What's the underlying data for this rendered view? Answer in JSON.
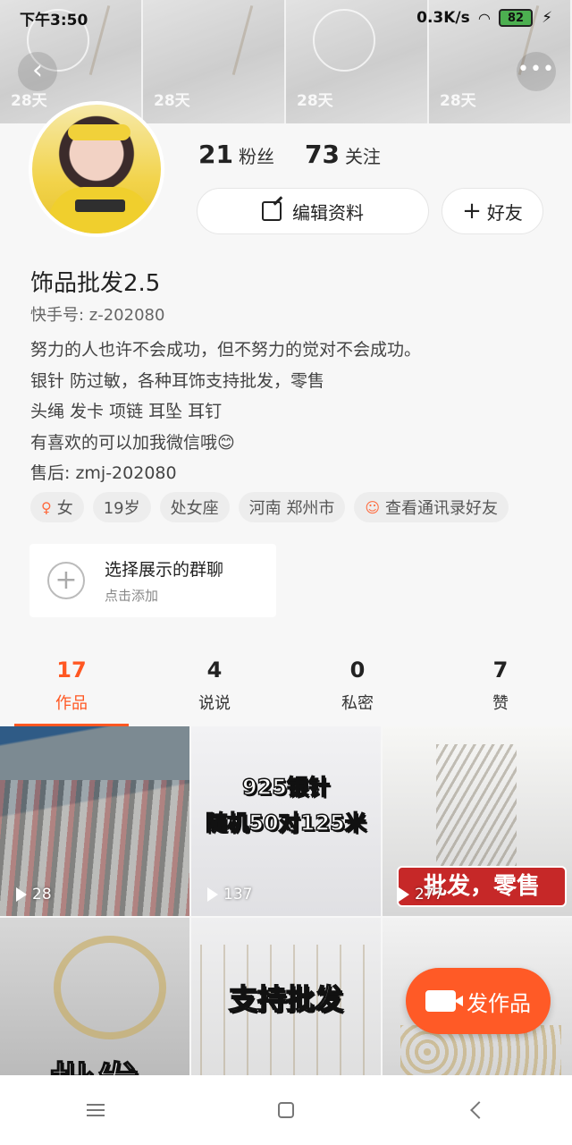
{
  "status_bar": {
    "time": "下午3:50",
    "network_speed": "0.3K/s",
    "battery": "82"
  },
  "cover": {
    "tiles": [
      {
        "days": "28天"
      },
      {
        "days": "28天"
      },
      {
        "days": "28天"
      },
      {
        "days": "28天"
      }
    ]
  },
  "header": {
    "back_icon": "‹",
    "more_icon": "•••"
  },
  "profile": {
    "fans_count": "21",
    "fans_label": "粉丝",
    "following_count": "73",
    "following_label": "关注",
    "edit_label": "编辑资料",
    "add_friend_label": "好友",
    "name": "饰品批发2.5",
    "id_label": "快手号: z-202080",
    "bio": [
      "努力的人也许不会成功，但不努力的觉对不会成功。",
      "银针 防过敏，各种耳饰支持批发，零售",
      "头绳 发卡 项链 耳坠 耳钉",
      "有喜欢的可以加我微信哦😊",
      "售后: zmj-202080"
    ],
    "tags": [
      {
        "icon": "♀",
        "label": "女"
      },
      {
        "label": "19岁"
      },
      {
        "label": "处女座"
      },
      {
        "label": "河南 郑州市"
      },
      {
        "icon": "☺",
        "label": "查看通讯录好友"
      }
    ],
    "group_card": {
      "title": "选择展示的群聊",
      "subtitle": "点击添加"
    }
  },
  "tabs": [
    {
      "count": "17",
      "label": "作品"
    },
    {
      "count": "4",
      "label": "说说"
    },
    {
      "count": "0",
      "label": "私密"
    },
    {
      "count": "7",
      "label": "赞"
    }
  ],
  "grid": [
    {
      "views": "28"
    },
    {
      "views": "137",
      "text1": "925银针",
      "text2": "随机50对125米"
    },
    {
      "views": "277",
      "banner": "批发，零售"
    },
    {
      "text": "批发"
    },
    {
      "text": "支持批发"
    },
    {}
  ],
  "fab": {
    "label": "发作品"
  },
  "colors": {
    "accent": "#ff5722",
    "fab": "#ff5a26",
    "background": "#f7f7f7"
  }
}
